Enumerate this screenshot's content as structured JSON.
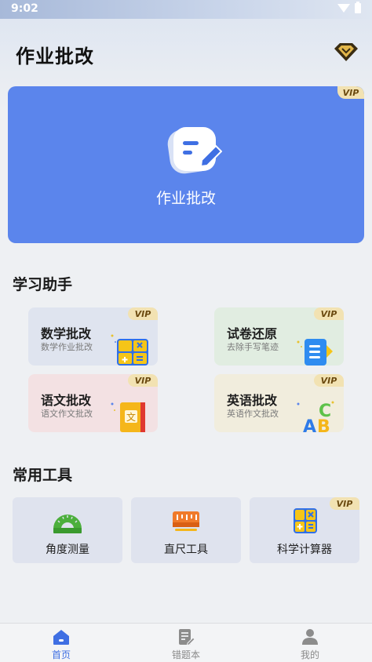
{
  "status": {
    "time": "9:02"
  },
  "header": {
    "title": "作业批改"
  },
  "hero": {
    "label": "作业批改",
    "vip": "VIP"
  },
  "study": {
    "title": "学习助手",
    "cards": [
      {
        "title": "数学批改",
        "subtitle": "数学作业批改",
        "vip": "VIP"
      },
      {
        "title": "试卷还原",
        "subtitle": "去除手写笔迹",
        "vip": "VIP"
      },
      {
        "title": "语文批改",
        "subtitle": "语文作文批改",
        "vip": "VIP"
      },
      {
        "title": "英语批改",
        "subtitle": "英语作文批改",
        "vip": "VIP"
      }
    ]
  },
  "tools": {
    "title": "常用工具",
    "items": [
      {
        "label": "角度测量"
      },
      {
        "label": "直尺工具"
      },
      {
        "label": "科学计算器",
        "vip": "VIP"
      }
    ]
  },
  "tabbar": {
    "tabs": [
      {
        "label": "首页",
        "active": true
      },
      {
        "label": "错题本"
      },
      {
        "label": "我的"
      }
    ]
  },
  "colors": {
    "accent": "#3f6fe3",
    "hero_bg": "#5b85ec",
    "vip_tag": "#f2e2b2"
  }
}
